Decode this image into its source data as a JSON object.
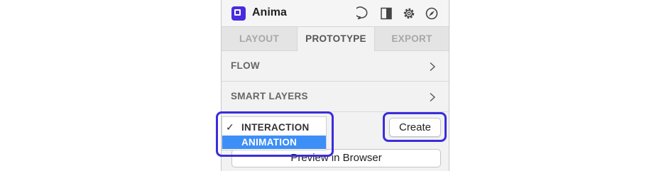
{
  "app": {
    "title": "Anima"
  },
  "header_icons": [
    "chat-icon",
    "panel-icon",
    "gear-icon",
    "compass-icon"
  ],
  "tabs": [
    {
      "label": "LAYOUT",
      "active": false
    },
    {
      "label": "PROTOTYPE",
      "active": true
    },
    {
      "label": "EXPORT",
      "active": false
    }
  ],
  "sections": [
    {
      "label": "FLOW"
    },
    {
      "label": "SMART LAYERS"
    }
  ],
  "dropdown": {
    "options": [
      {
        "label": "INTERACTION",
        "checked": true,
        "check_mark": "✓"
      },
      {
        "label": "ANIMATION",
        "highlighted": true
      }
    ]
  },
  "create_button": {
    "label": "Create"
  },
  "preview_button": {
    "label": "Preview in Browser"
  },
  "colors": {
    "brand": "#4a2bdf",
    "highlight": "#3d8ff7",
    "annotation": "#3b2ddb"
  }
}
